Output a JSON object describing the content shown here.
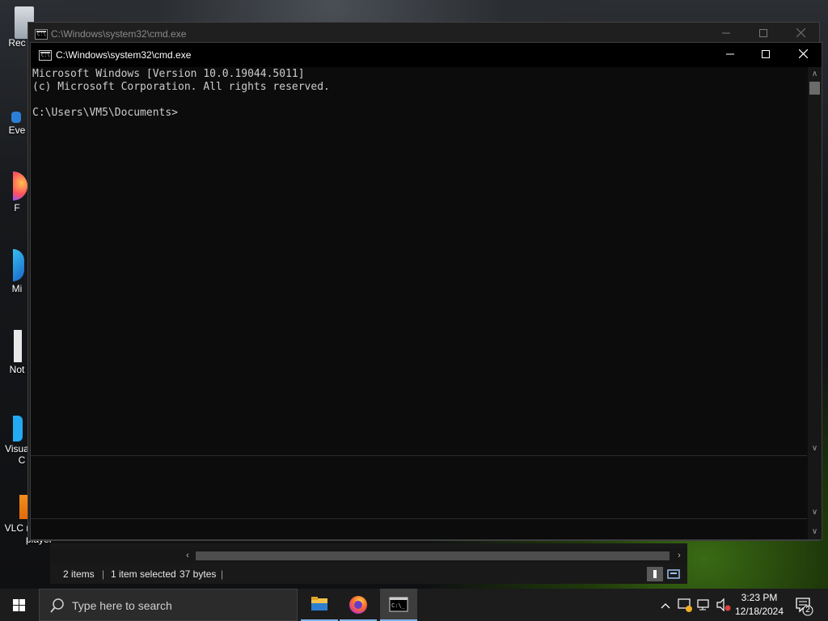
{
  "desktop": {
    "icons": [
      {
        "label": "Rec"
      },
      {
        "label": "Eve"
      },
      {
        "label": "F"
      },
      {
        "label": "Mi"
      },
      {
        "label": "Not"
      },
      {
        "label": "Visua"
      },
      {
        "label": "C"
      },
      {
        "label": "VLC r"
      },
      {
        "label": "player"
      }
    ]
  },
  "cmd_back": {
    "title": "C:\\Windows\\system32\\cmd.exe"
  },
  "cmd_front": {
    "title": "C:\\Windows\\system32\\cmd.exe",
    "lines": [
      "Microsoft Windows [Version 10.0.19044.5011]",
      "(c) Microsoft Corporation. All rights reserved.",
      "",
      "C:\\Users\\VM5\\Documents>"
    ]
  },
  "explorer": {
    "status": {
      "items": "2 items",
      "selected": "1 item selected",
      "size": "37 bytes"
    }
  },
  "taskbar": {
    "search_placeholder": "Type here to search",
    "time": "3:23 PM",
    "date": "12/18/2024",
    "notification_count": "2"
  },
  "colors": {
    "console_bg": "#0c0c0c",
    "console_text": "#cccccc",
    "taskbar_bg": "#1c1c1c",
    "active_underline": "#7eb4ea"
  }
}
